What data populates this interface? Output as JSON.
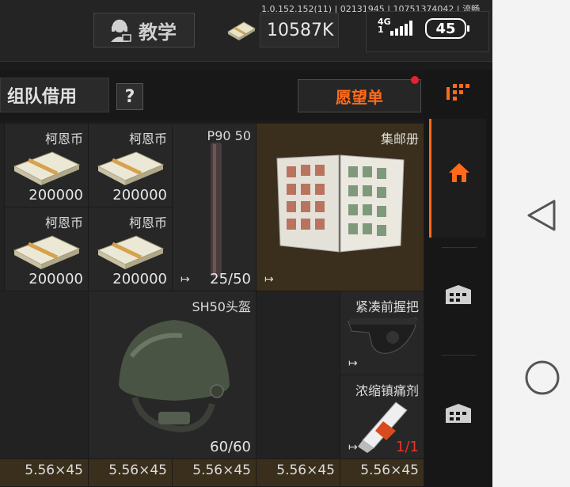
{
  "status": {
    "version": "1.0.152.152(11) | 02131945 | 10751374042 | 流畅",
    "network": "4G",
    "network_sub": "1",
    "battery": "45"
  },
  "header": {
    "teach_label": "教学",
    "money": "10587K"
  },
  "toolbar": {
    "team_borrow_label": "组队借用",
    "help_label": "?",
    "wishlist_label": "愿望单"
  },
  "items": {
    "coin1": {
      "name": "柯恩币",
      "qty": "200000"
    },
    "coin2": {
      "name": "柯恩币",
      "qty": "200000"
    },
    "coin3": {
      "name": "柯恩币",
      "qty": "200000"
    },
    "coin4": {
      "name": "柯恩币",
      "qty": "200000"
    },
    "p90": {
      "name": "P90 50",
      "qty": "25/50"
    },
    "album": {
      "name": "集邮册"
    },
    "helmet": {
      "name": "SH50头盔",
      "qty": "60/60"
    },
    "grip": {
      "name": "紧凑前握把"
    },
    "painkiller": {
      "name": "浓缩镇痛剂",
      "qty": "1/1"
    },
    "ammo_row": [
      "5.56×45",
      "5.56×45",
      "5.56×45",
      "5.56×45",
      "5.56×45"
    ]
  },
  "colors": {
    "accent": "#ff6b1a",
    "alert": "#e8212c",
    "gold_cell": "#3a2f1c"
  },
  "icons": {
    "teach": "headset-user-icon",
    "money": "cash-stack-icon",
    "sidebar_top": "grid-dots-icon",
    "home": "home-icon",
    "storage": "crate-icon",
    "back": "back-triangle-icon",
    "home_nav": "home-circle-icon"
  }
}
